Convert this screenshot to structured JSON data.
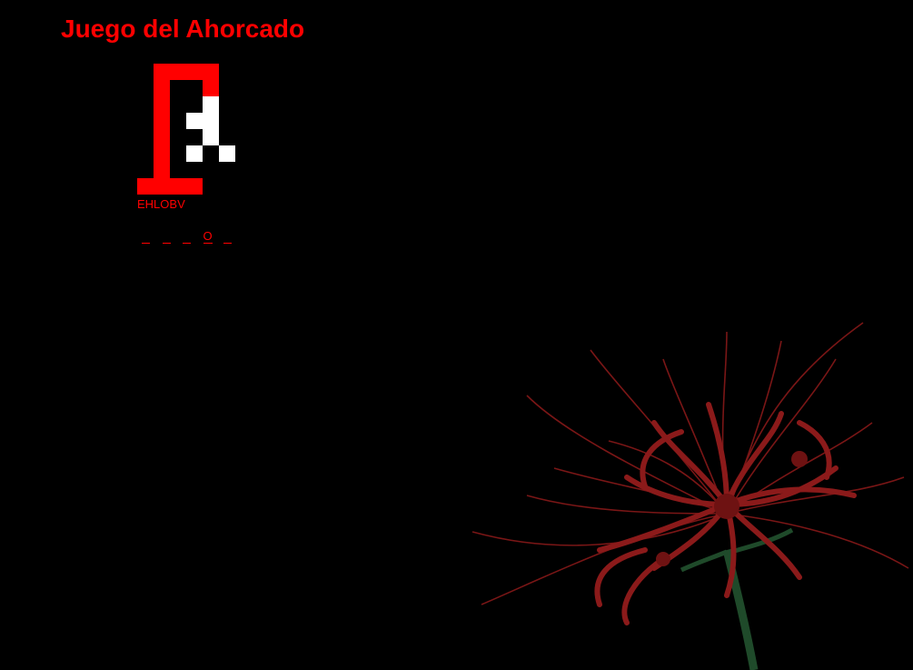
{
  "game": {
    "title": "Juego del Ahorcado",
    "used_letters": "EHLOBV",
    "word_slots": [
      "",
      "",
      "",
      "O",
      ""
    ]
  },
  "colors": {
    "background": "#000000",
    "accent": "#ff0000",
    "figure": "#ffffff",
    "flower": "#8b1a1a",
    "stem": "#1f4a2a"
  },
  "icons": {
    "gallows": "gallows-pixel-icon",
    "decoration": "red-spider-lily-image"
  }
}
